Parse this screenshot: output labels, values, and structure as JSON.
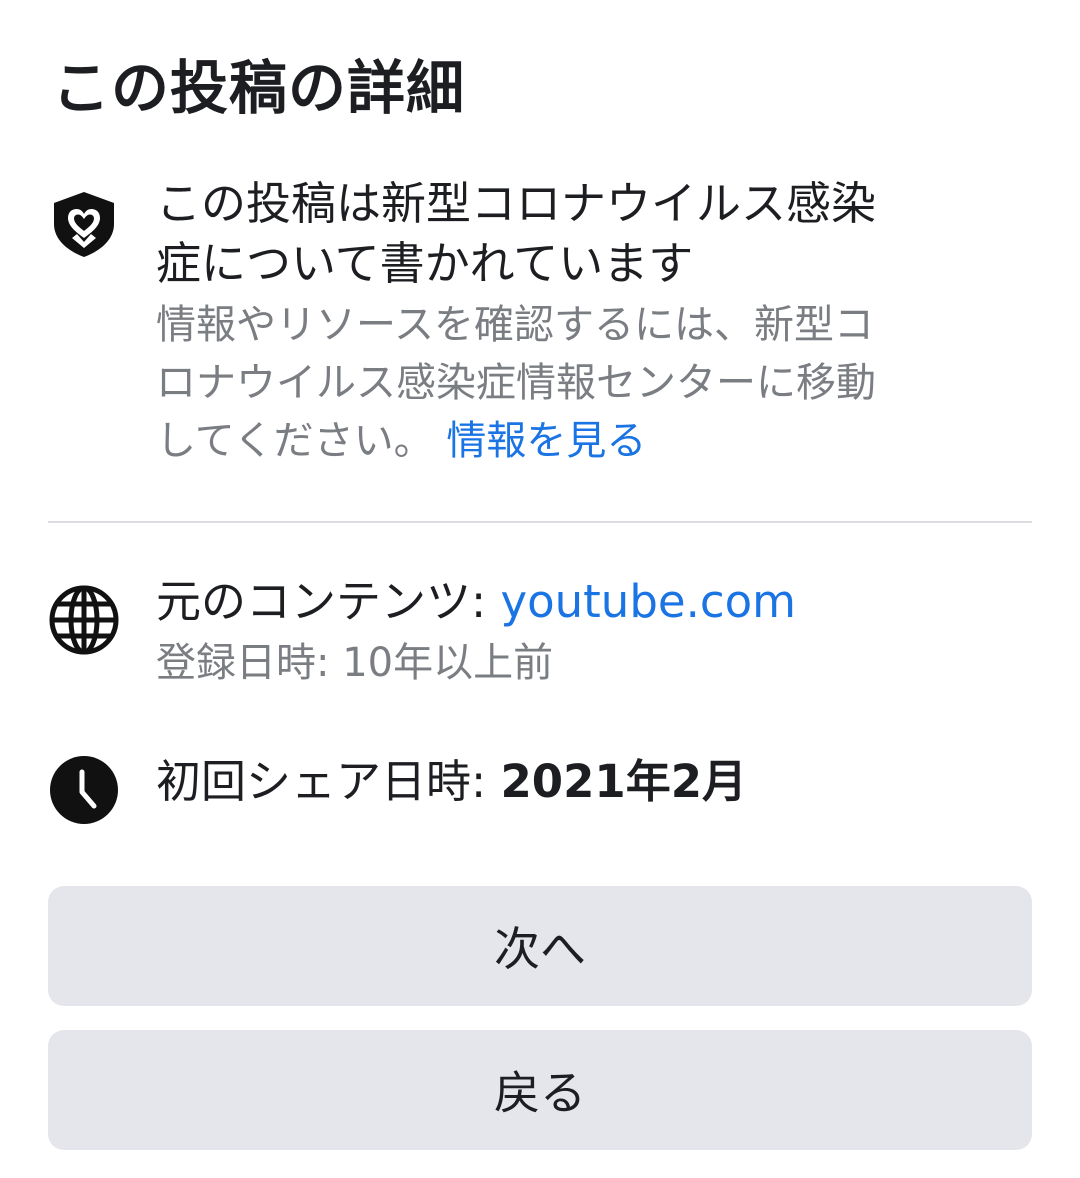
{
  "header": {
    "title": "この投稿の詳細"
  },
  "covid_notice": {
    "icon": "shield-heart-icon",
    "title_line1": "この投稿は新型コロナウイルス感染",
    "title_line2": "症について書かれています",
    "desc_line1": "情報やリソースを確認するには、新型コ",
    "desc_line2": "ロナウイルス感染症情報センターに移動",
    "desc_line3": "してください。",
    "link_label": "情報を見る"
  },
  "source": {
    "icon": "globe-icon",
    "label": "元のコンテンツ: ",
    "domain": "youtube.com",
    "registered": "登録日時: 10年以上前"
  },
  "first_shared": {
    "icon": "clock-icon",
    "label": "初回シェア日時: ",
    "value": "2021年2月"
  },
  "buttons": {
    "next_label": "次へ",
    "back_label": "戻る"
  },
  "colors": {
    "link": "#1b74e4",
    "button_bg": "#e4e6eb",
    "secondary_text": "#7a7d82"
  }
}
